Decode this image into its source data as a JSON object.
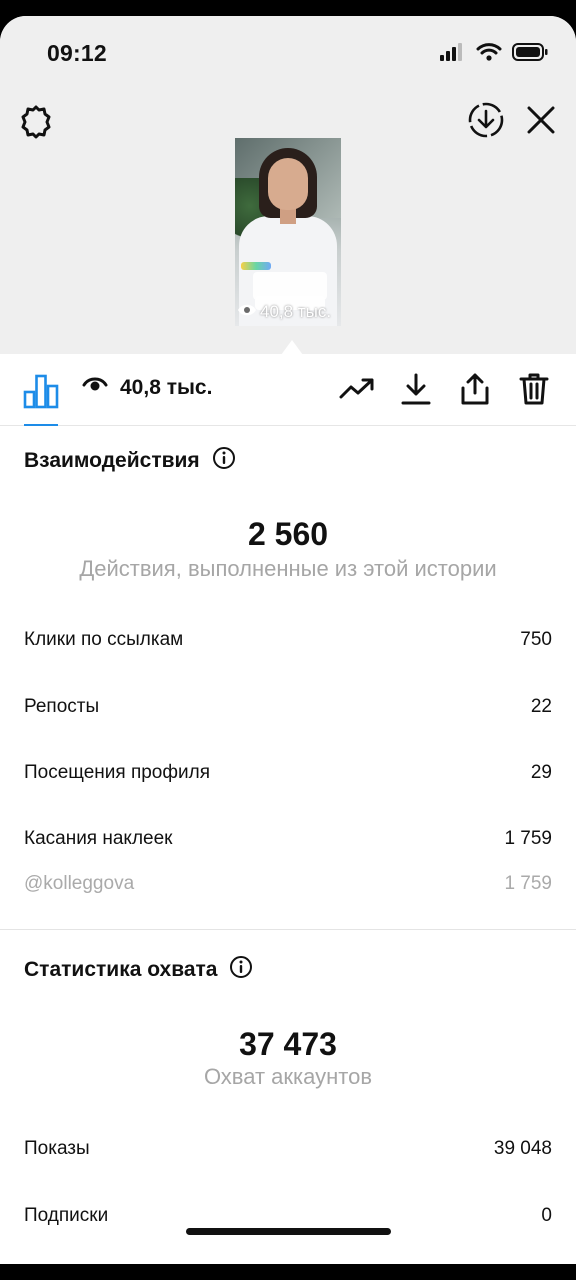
{
  "status_bar": {
    "time": "09:12"
  },
  "story_header": {
    "thumbnail_views": "40,8 тыс."
  },
  "toolbar": {
    "views": "40,8 тыс."
  },
  "interactions": {
    "title": "Взаимодействия",
    "total": "2 560",
    "total_caption": "Действия, выполненные из этой истории",
    "rows": [
      {
        "label": "Клики по ссылкам",
        "value": "750"
      },
      {
        "label": "Репосты",
        "value": "22"
      },
      {
        "label": "Посещения профиля",
        "value": "29"
      },
      {
        "label": "Касания наклеек",
        "value": "1 759"
      },
      {
        "label": "@kolleggova",
        "value": "1 759"
      }
    ]
  },
  "reach": {
    "title": "Статистика охвата",
    "total": "37 473",
    "total_caption": "Охват аккаунтов",
    "rows": [
      {
        "label": "Показы",
        "value": "39 048"
      },
      {
        "label": "Подписки",
        "value": "0"
      }
    ]
  },
  "colors": {
    "accent": "#1d8ce8",
    "muted_text": "#a6a6a6"
  },
  "icons": [
    "gear-icon",
    "download-circle-icon",
    "close-icon",
    "bar-chart-icon",
    "eye-icon",
    "trend-icon",
    "download-icon",
    "share-icon",
    "trash-icon",
    "info-icon"
  ]
}
